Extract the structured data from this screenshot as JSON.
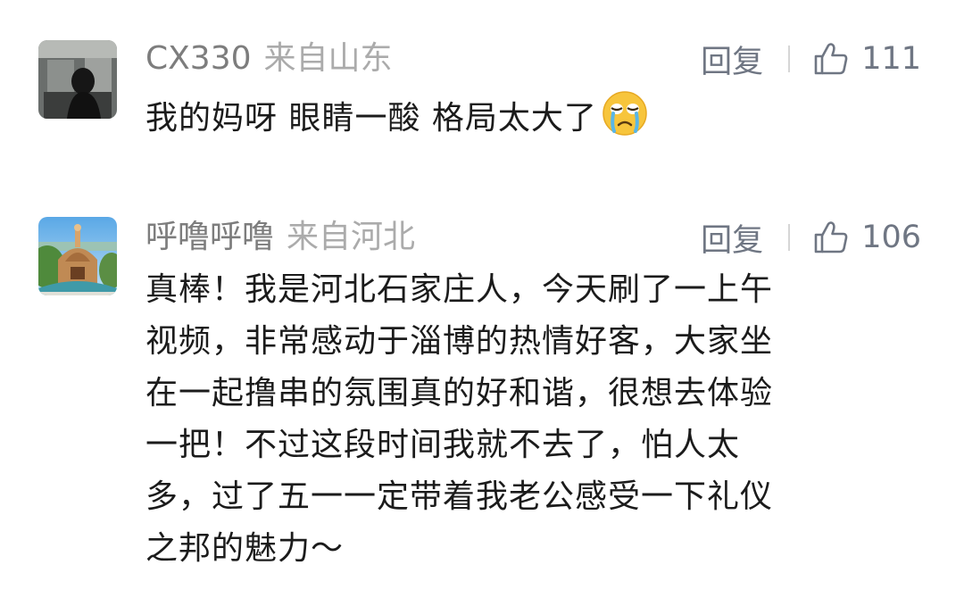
{
  "comments": [
    {
      "username": "CX330",
      "location": "来自山东",
      "reply_label": "回复",
      "like_count": "111",
      "lines": [
        "我的妈呀 眼睛一酸 格局太大了"
      ],
      "emoji": "crying-face-icon"
    },
    {
      "username": "呼噜呼噜",
      "location": "来自河北",
      "reply_label": "回复",
      "like_count": "106",
      "lines": [
        "真棒！我是河北石家庄人，今天刷了一上午",
        "视频，非常感动于淄博的热情好客，大家坐",
        "在一起撸串的氛围真的好和谐，很想去体验",
        "一把！不过这段时间我就不去了，怕人太",
        "多，过了五一一定带着我老公感受一下礼仪",
        "之邦的魅力～"
      ]
    }
  ],
  "colors": {
    "username": "#7d7d7d",
    "location": "#ababab",
    "action": "#6f7683",
    "body": "#1b1b1b",
    "divider": "#d6d6d6"
  }
}
